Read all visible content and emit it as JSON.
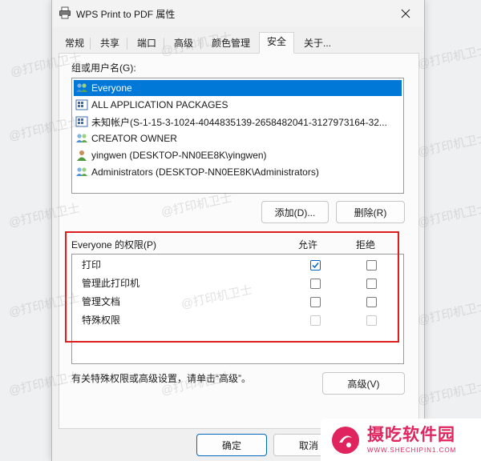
{
  "window": {
    "title": "WPS Print to PDF 属性",
    "close_icon": "close-icon"
  },
  "tabs": [
    {
      "label": "常规"
    },
    {
      "label": "共享"
    },
    {
      "label": "端口"
    },
    {
      "label": "高级"
    },
    {
      "label": "颜色管理"
    },
    {
      "label": "安全",
      "active": true
    },
    {
      "label": "关于..."
    }
  ],
  "security": {
    "users_label": "组或用户名(G):",
    "users": [
      {
        "name": "Everyone",
        "icon": "users-group-icon",
        "selected": true
      },
      {
        "name": "ALL APPLICATION PACKAGES",
        "icon": "app-packages-icon",
        "selected": false
      },
      {
        "name": "未知帐户(S-1-15-3-1024-4044835139-2658482041-3127973164-32...",
        "icon": "app-packages-icon",
        "selected": false
      },
      {
        "name": "CREATOR OWNER",
        "icon": "users-group-icon",
        "selected": false
      },
      {
        "name": "yingwen (DESKTOP-NN0EE8K\\yingwen)",
        "icon": "user-icon",
        "selected": false
      },
      {
        "name": "Administrators (DESKTOP-NN0EE8K\\Administrators)",
        "icon": "users-group-icon",
        "selected": false
      }
    ],
    "add_button": "添加(D)...",
    "remove_button": "删除(R)",
    "permissions_label": "Everyone 的权限(P)",
    "allow_header": "允许",
    "deny_header": "拒绝",
    "permissions": [
      {
        "name": "打印",
        "allow": true,
        "deny": false,
        "disabled": false
      },
      {
        "name": "管理此打印机",
        "allow": false,
        "deny": false,
        "disabled": false
      },
      {
        "name": "管理文档",
        "allow": false,
        "deny": false,
        "disabled": false
      },
      {
        "name": "特殊权限",
        "allow": false,
        "deny": false,
        "disabled": true
      }
    ],
    "advanced_hint": "有关特殊权限或高级设置，请单击“高级”。",
    "advanced_button": "高级(V)"
  },
  "footer": {
    "ok_button": "确定",
    "cancel_button": "取消"
  },
  "watermark_text": "@打印机卫士",
  "brand": {
    "name": "摄吃软件园",
    "url": "WWW.SHECHIPIN1.COM",
    "color": "#e0245e"
  },
  "colors": {
    "selection": "#0078d7",
    "highlight_frame": "#e01d1d",
    "checkbox_accent": "#0067c0"
  }
}
